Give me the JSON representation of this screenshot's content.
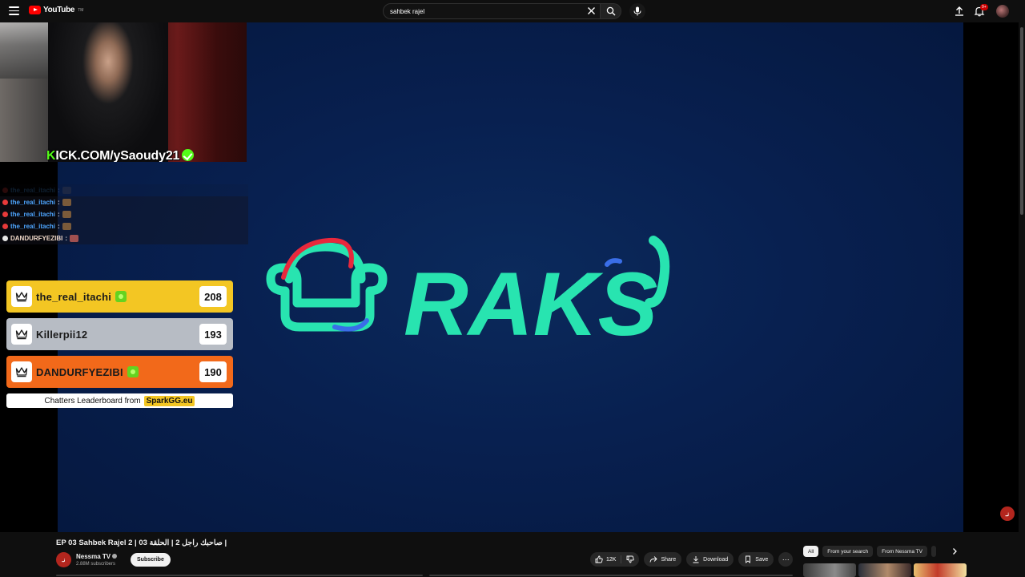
{
  "app": {
    "logo_text": "YouTube",
    "logo_tm": "TM",
    "brand_color": "#ff0000"
  },
  "search": {
    "value": "sahbek rajel",
    "clear_icon": "close-icon",
    "search_icon": "search-icon",
    "mic_icon": "mic-icon"
  },
  "header": {
    "notifications_badge": "9+",
    "icons": [
      "menu-icon",
      "upload-icon",
      "bell-icon",
      "avatar"
    ]
  },
  "overlay": {
    "cam_caption_k": "K",
    "cam_caption_rest": "ICK.COM/ySaoudy21",
    "chat": [
      {
        "user": "the_real_itachi",
        "faded": true
      },
      {
        "user": "the_real_itachi",
        "faded": false
      },
      {
        "user": "the_real_itachi",
        "faded": false
      },
      {
        "user": "the_real_itachi",
        "faded": false
      },
      {
        "user": "DANDURFYEZIBI",
        "faded": false
      }
    ],
    "leaderboard": [
      {
        "name": "the_real_itachi",
        "score": "208",
        "badge": true
      },
      {
        "name": "Killerpii12",
        "score": "193",
        "badge": false
      },
      {
        "name": "DANDURFYEZIBI",
        "score": "190",
        "badge": true
      }
    ],
    "leaderboard_footer": "Chatters Leaderboard from",
    "leaderboard_brand": "SparkGG.eu",
    "logo_word": "RAKS",
    "watermark": "نـ"
  },
  "video": {
    "title": "EP 03 Sahbek Rajel 2 | صاحبك راجل 2 | الحلقة 03 |",
    "channel_name": "Nessma TV",
    "channel_avatar": "نـ",
    "subscribers": "2.88M subscribers",
    "subscribe_label": "Subscribe",
    "like_count": "12K",
    "share_label": "Share",
    "download_label": "Download",
    "save_label": "Save",
    "more_label": "···"
  },
  "filters": {
    "chips": [
      "All",
      "From your search",
      "From Nessma TV"
    ],
    "active_index": 0
  }
}
